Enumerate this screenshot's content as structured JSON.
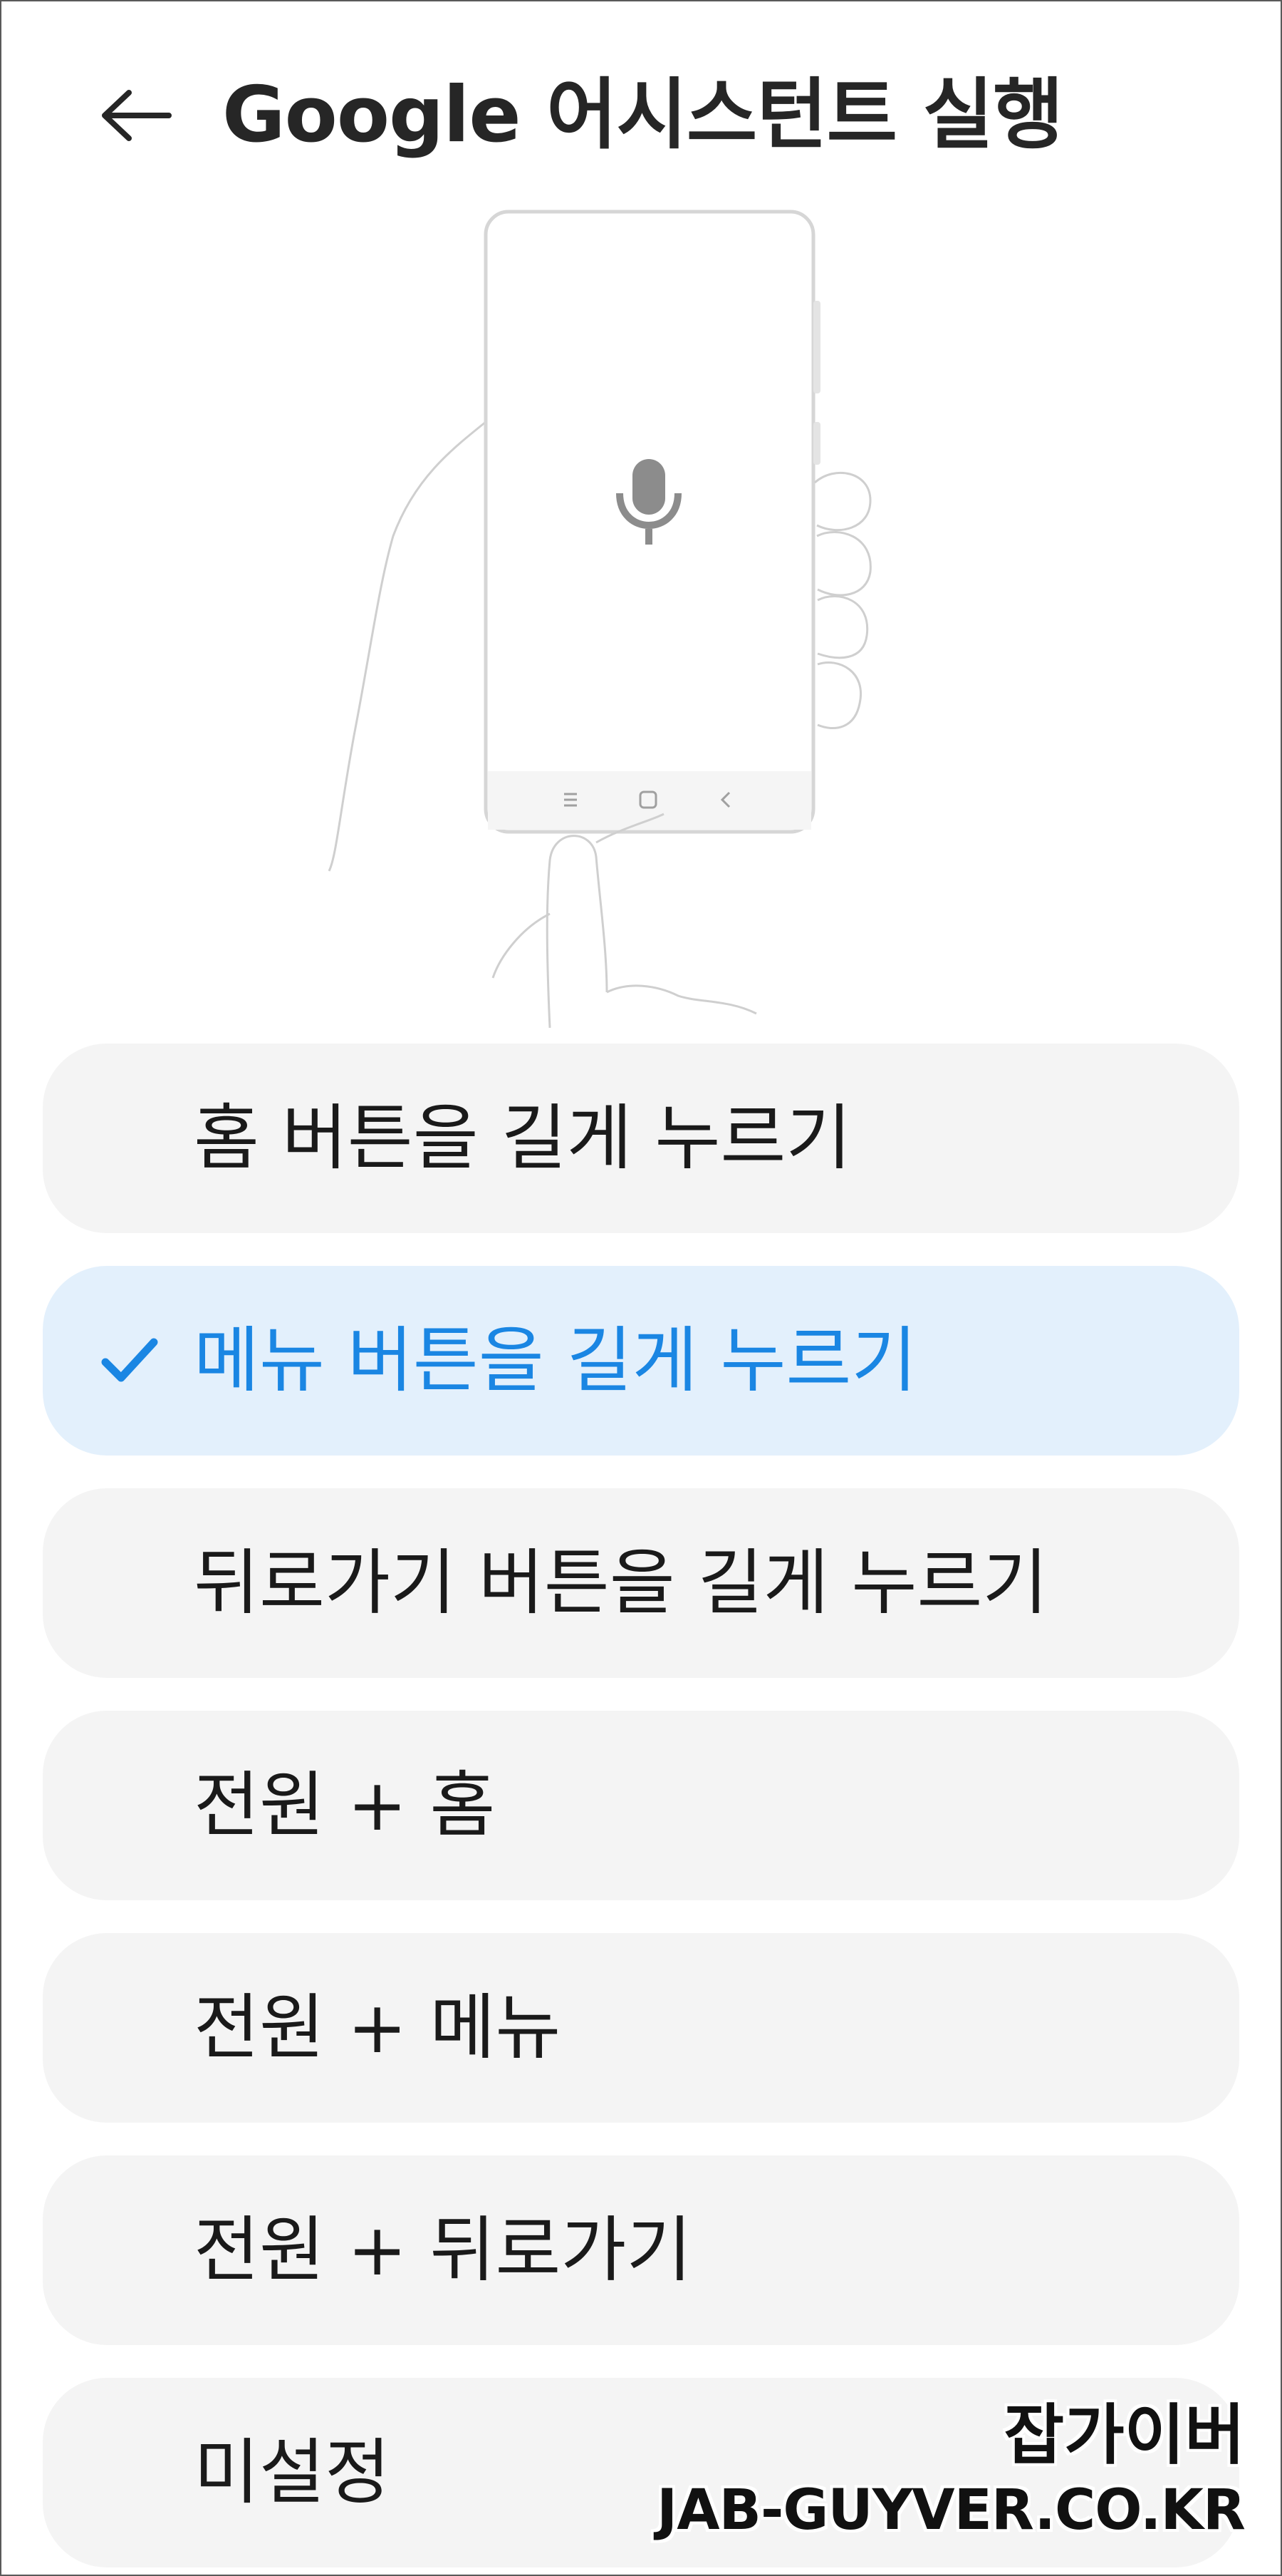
{
  "header": {
    "title": "Google 어시스턴트 실행",
    "back_icon": "arrow-left-icon"
  },
  "illustration": {
    "description_icon": "microphone-icon",
    "nav_icons": [
      "recents-icon",
      "home-icon",
      "back-icon"
    ]
  },
  "options": [
    {
      "label": "홈 버튼을 길게 누르기",
      "selected": false
    },
    {
      "label": "메뉴 버튼을 길게 누르기",
      "selected": true
    },
    {
      "label": "뒤로가기 버튼을 길게 누르기",
      "selected": false
    },
    {
      "label": "전원 + 홈",
      "selected": false
    },
    {
      "label": "전원 + 메뉴",
      "selected": false
    },
    {
      "label": "전원 + 뒤로가기",
      "selected": false
    },
    {
      "label": "미설정",
      "selected": false
    }
  ],
  "colors": {
    "accent": "#1a86e3",
    "selected_bg": "#e3f0fc",
    "option_bg": "#f4f4f4"
  },
  "watermark": {
    "title": "잡가이버",
    "url": "JAB-GUYVER.CO.KR"
  }
}
